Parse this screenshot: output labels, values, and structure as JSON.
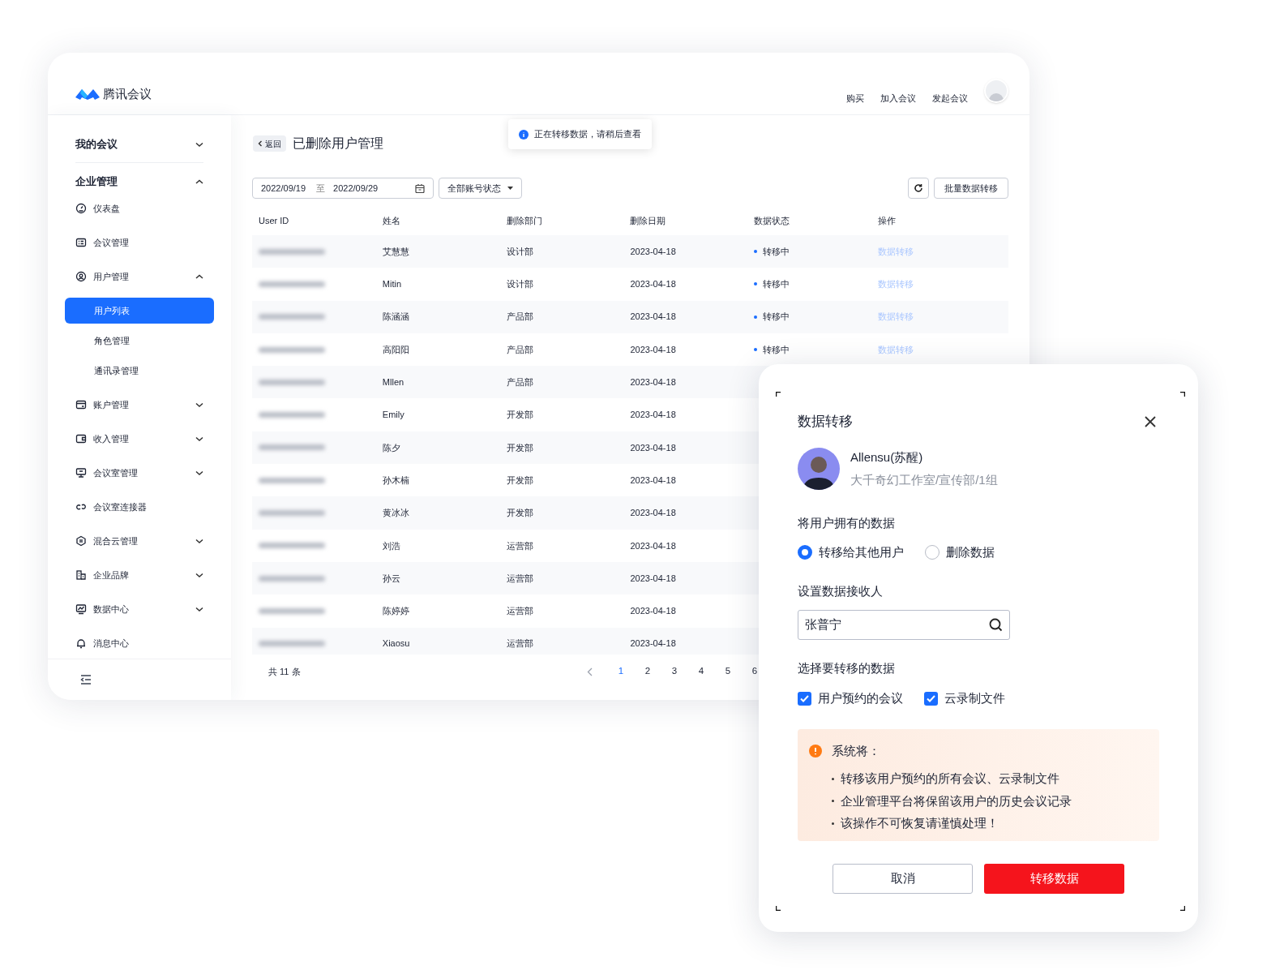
{
  "app": {
    "logo_text": "腾讯会议",
    "nav_links": [
      "购买",
      "加入会议",
      "发起会议"
    ]
  },
  "sidebar": {
    "sections": [
      {
        "label": "我的会议",
        "expanded": false
      },
      {
        "label": "企业管理",
        "expanded": true,
        "children": [
          {
            "label": "仪表盘",
            "kind": "link",
            "selected": false
          },
          {
            "label": "会议管理",
            "kind": "link",
            "selected": false
          },
          {
            "label": "用户管理",
            "kind": "group",
            "expanded": true,
            "selected": false,
            "children": [
              {
                "label": "用户列表",
                "selected": true
              },
              {
                "label": "角色管理",
                "selected": false
              },
              {
                "label": "通讯录管理",
                "selected": false
              }
            ]
          },
          {
            "label": "账户管理",
            "kind": "group",
            "expanded": false,
            "selected": false
          },
          {
            "label": "收入管理",
            "kind": "group",
            "expanded": false,
            "selected": false
          },
          {
            "label": "会议室管理",
            "kind": "group",
            "expanded": false,
            "selected": false
          },
          {
            "label": "会议室连接器",
            "kind": "link",
            "selected": false
          },
          {
            "label": "混合云管理",
            "kind": "group",
            "expanded": false,
            "selected": false
          },
          {
            "label": "企业品牌",
            "kind": "group",
            "expanded": false,
            "selected": false
          },
          {
            "label": "数据中心",
            "kind": "group",
            "expanded": false,
            "selected": false
          },
          {
            "label": "消息中心",
            "kind": "link",
            "selected": false
          }
        ]
      }
    ]
  },
  "toast": "正在转移数据，请稍后查看",
  "page": {
    "back": "返回",
    "title": "已删除用户管理"
  },
  "filters": {
    "date_start": "2022/09/19",
    "separator": "至",
    "date_end": "2022/09/29",
    "status_filter": "全部账号状态",
    "batch_button": "批量数据转移"
  },
  "table": {
    "columns": [
      "User ID",
      "姓名",
      "删除部门",
      "删除日期",
      "数据状态",
      "操作"
    ],
    "rows": [
      {
        "name": "艾慧慧",
        "department": "设计部",
        "date": "2023-04-18",
        "status": {
          "label": "转移中",
          "color": "#1a6dff"
        },
        "action": {
          "label": "数据转移",
          "disabled": true
        }
      },
      {
        "name": "Mitin",
        "department": "设计部",
        "date": "2023-04-18",
        "status": {
          "label": "转移中",
          "color": "#1a6dff"
        },
        "action": {
          "label": "数据转移",
          "disabled": true
        }
      },
      {
        "name": "陈涵涵",
        "department": "产品部",
        "date": "2023-04-18",
        "status": {
          "label": "转移中",
          "color": "#1a6dff"
        },
        "action": {
          "label": "数据转移",
          "disabled": true
        }
      },
      {
        "name": "高阳阳",
        "department": "产品部",
        "date": "2023-04-18",
        "status": {
          "label": "转移中",
          "color": "#1a6dff"
        },
        "action": {
          "label": "数据转移",
          "disabled": true
        }
      },
      {
        "name": "Mllen",
        "department": "产品部",
        "date": "2023-04-18"
      },
      {
        "name": "Emily",
        "department": "开发部",
        "date": "2023-04-18"
      },
      {
        "name": "陈夕",
        "department": "开发部",
        "date": "2023-04-18"
      },
      {
        "name": "孙木楠",
        "department": "开发部",
        "date": "2023-04-18"
      },
      {
        "name": "黄冰冰",
        "department": "开发部",
        "date": "2023-04-18"
      },
      {
        "name": "刘浩",
        "department": "运营部",
        "date": "2023-04-18"
      },
      {
        "name": "孙云",
        "department": "运营部",
        "date": "2023-04-18"
      },
      {
        "name": "陈婷婷",
        "department": "运营部",
        "date": "2023-04-18"
      },
      {
        "name": "Xiaosu",
        "department": "运营部",
        "date": "2023-04-18"
      }
    ]
  },
  "pagination": {
    "total": "共 11 条",
    "pages": [
      {
        "label": "1",
        "selected": true
      },
      {
        "label": "2",
        "selected": false
      },
      {
        "label": "3",
        "selected": false
      },
      {
        "label": "4",
        "selected": false
      },
      {
        "label": "5",
        "selected": false
      },
      {
        "label": "6",
        "selected": false
      }
    ]
  },
  "dialog": {
    "title": "数据转移",
    "user_name": "Allensu(苏醒)",
    "user_path": "大千奇幻工作室/宣传部/1组",
    "own_data_label": "将用户拥有的数据",
    "radios": [
      {
        "label": "转移给其他用户",
        "selected": true
      },
      {
        "label": "删除数据",
        "selected": false
      }
    ],
    "recipient_label": "设置数据接收人",
    "recipient_value": "张普宁",
    "select_label": "选择要转移的数据",
    "checkboxes": [
      {
        "label": "用户预约的会议",
        "checked": true
      },
      {
        "label": "云录制文件",
        "checked": true
      }
    ],
    "notice": {
      "title": "系统将：",
      "items": [
        "转移该用户预约的所有会议、云录制文件",
        "企业管理平台将保留该用户的历史会议记录",
        "该操作不可恢复请谨慎处理！"
      ]
    },
    "buttons": {
      "cancel": "取消",
      "confirm": "转移数据"
    }
  }
}
